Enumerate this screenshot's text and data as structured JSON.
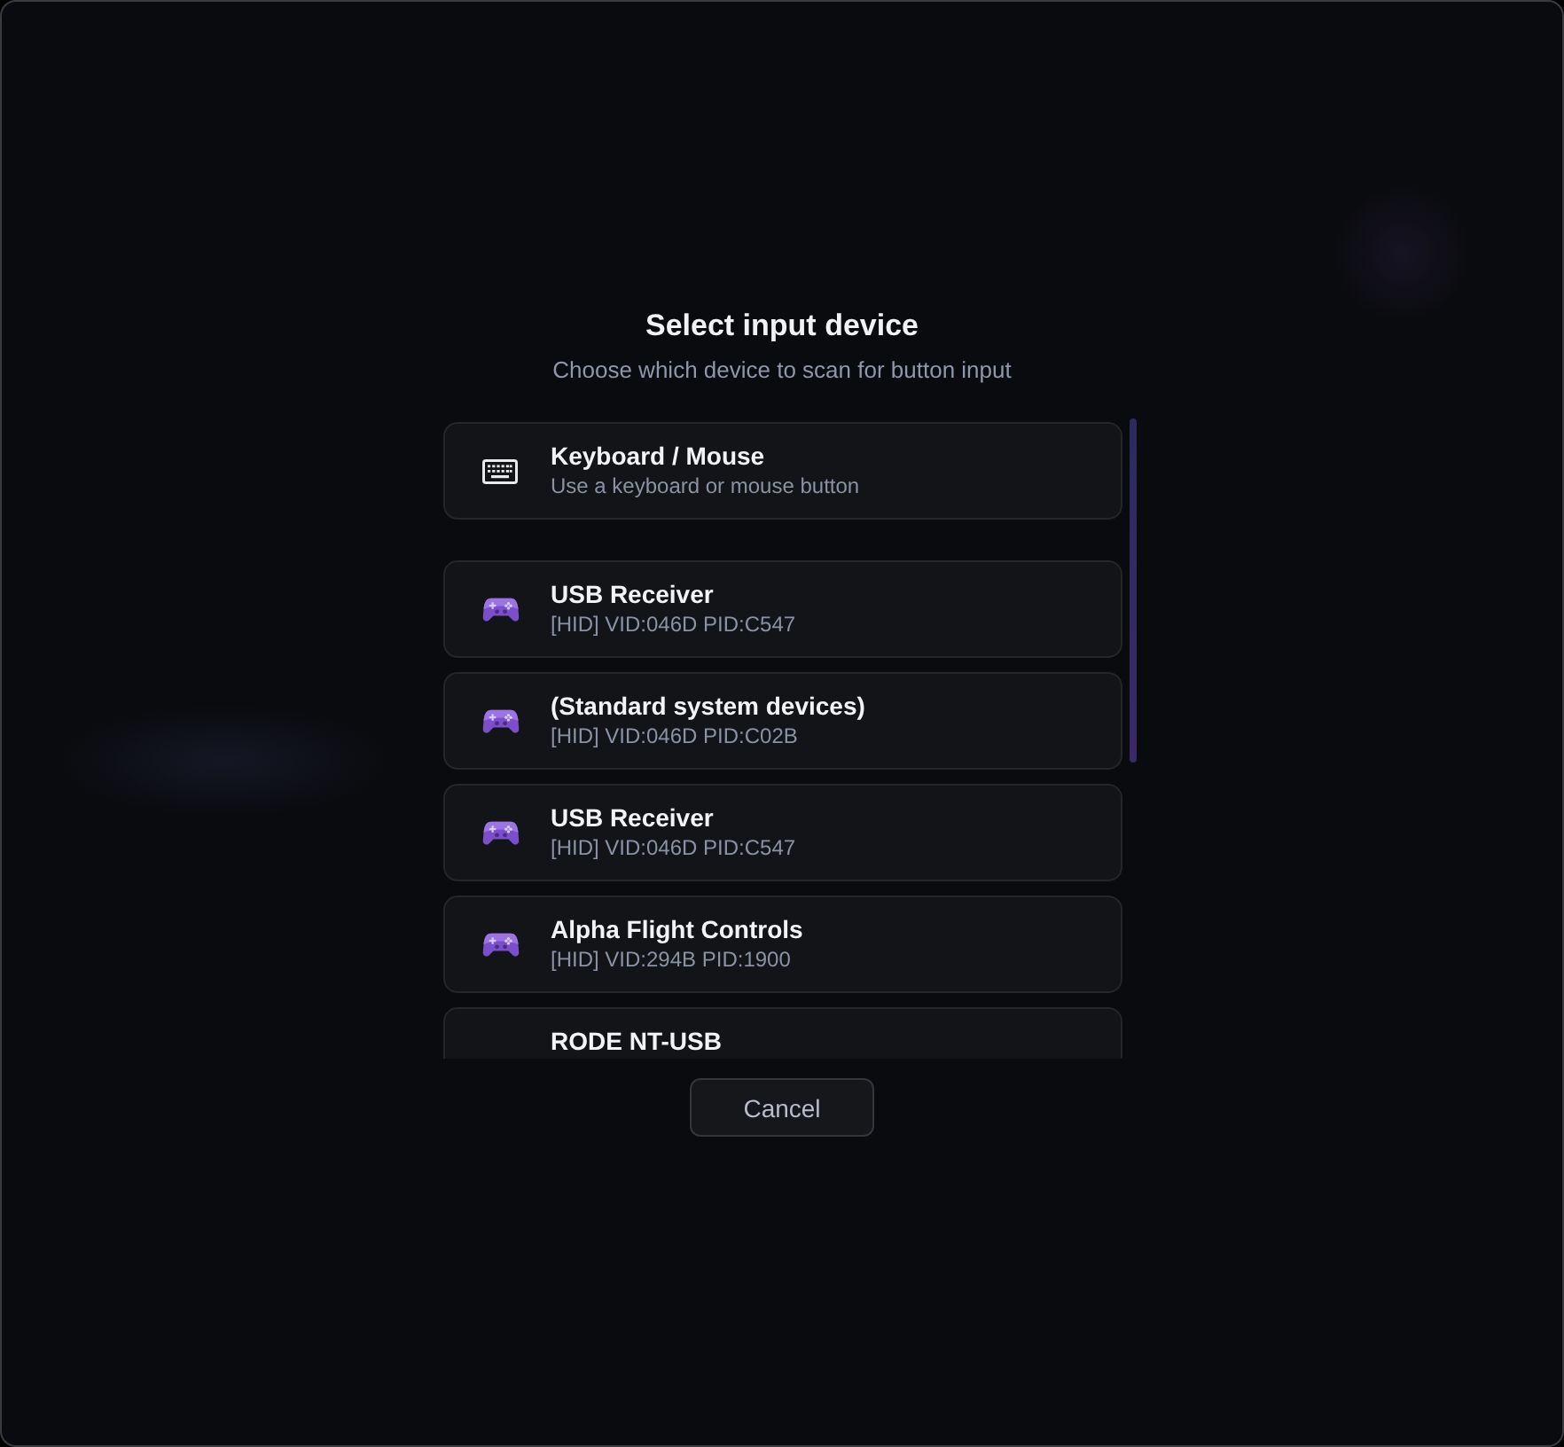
{
  "dialog": {
    "title": "Select input device",
    "subtitle": "Choose which device to scan for button input"
  },
  "sections": [
    {
      "devices": [
        {
          "kind": "keyboard",
          "name": "Keyboard / Mouse",
          "detail": "Use a keyboard or mouse button"
        }
      ]
    },
    {
      "devices": [
        {
          "kind": "gamepad",
          "name": "USB Receiver",
          "detail": "[HID] VID:046D PID:C547"
        },
        {
          "kind": "gamepad",
          "name": "(Standard system devices)",
          "detail": "[HID] VID:046D PID:C02B"
        },
        {
          "kind": "gamepad",
          "name": "USB Receiver",
          "detail": "[HID] VID:046D PID:C547"
        },
        {
          "kind": "gamepad",
          "name": "Alpha Flight Controls",
          "detail": "[HID] VID:294B PID:1900"
        },
        {
          "name": "RODE NT-USB"
        }
      ]
    }
  ],
  "buttons": [
    {
      "label": "Cancel"
    }
  ]
}
